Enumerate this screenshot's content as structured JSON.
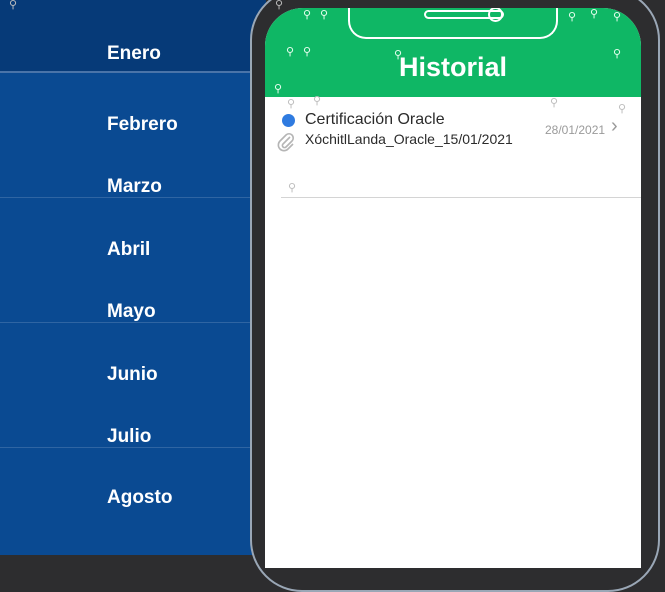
{
  "months": [
    "Enero",
    "Febrero",
    "Marzo",
    "Abril",
    "Mayo",
    "Junio",
    "Julio",
    "Agosto"
  ],
  "app": {
    "title": "Historial"
  },
  "history": [
    {
      "title": "Certificación Oracle",
      "file": "XóchitlLanda_Oracle_15/01/2021",
      "date": "28/01/2021"
    }
  ],
  "colors": {
    "appbar": "#0fb765",
    "list_bg": "#0a4a92",
    "header_bg": "#063a78"
  }
}
